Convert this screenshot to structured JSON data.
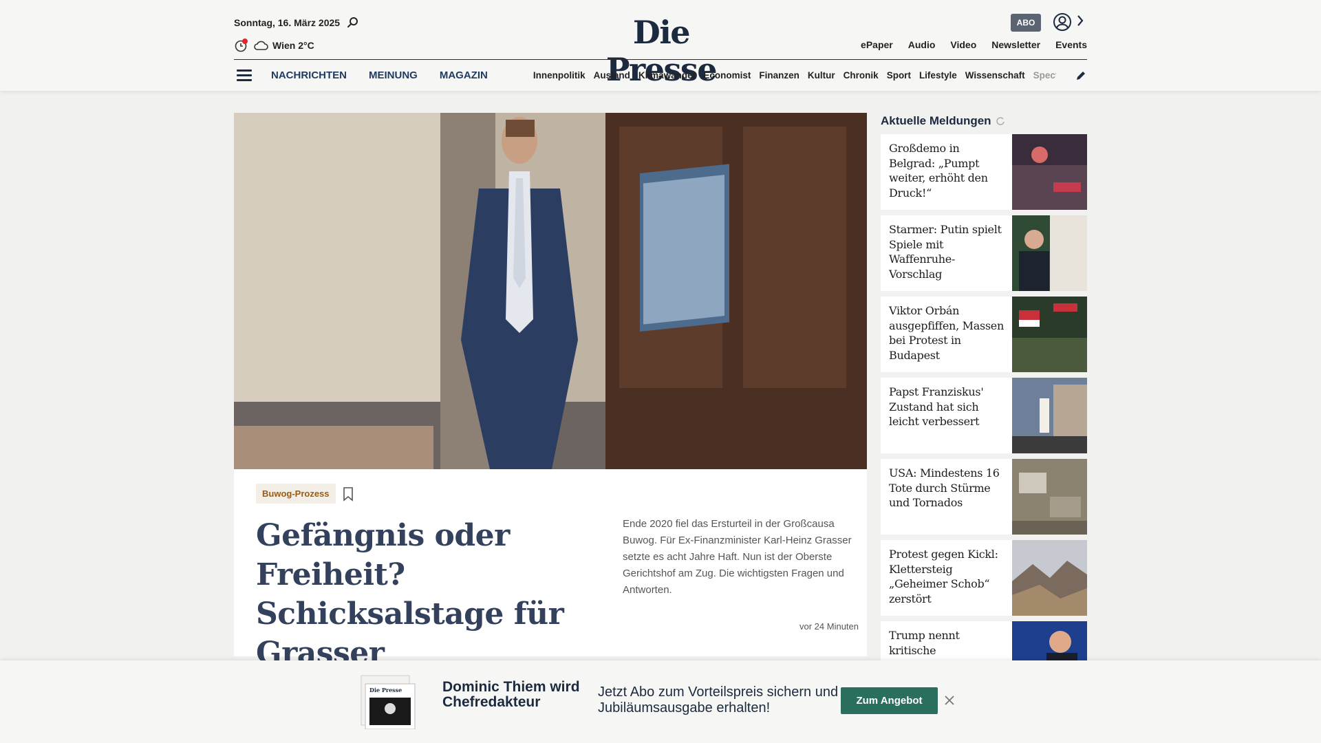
{
  "header": {
    "date": "Sonntag, 16. März 2025",
    "weather": "Wien 2°C",
    "logo": "Die Presse",
    "abo_label": "ABO",
    "top_links": [
      "ePaper",
      "Audio",
      "Video",
      "Newsletter",
      "Events"
    ],
    "nav_main": [
      "NACHRICHTEN",
      "MEINUNG",
      "MAGAZIN"
    ],
    "nav_sub": [
      "Innenpolitik",
      "Ausland",
      "Klimawandel",
      "Economist",
      "Finanzen",
      "Kultur",
      "Chronik",
      "Sport",
      "Lifestyle",
      "Wissenschaft",
      "Spectrum"
    ]
  },
  "hero": {
    "tag": "Buwog-Prozess",
    "headline": "Gefängnis oder Freiheit? Schicksalstage für Grasser",
    "teaser": "Ende 2020 fiel das Ersturteil in der Großcausa Buwog. Für Ex-Finanzminister Karl-Heinz Grasser setzte es acht Jahre Haft. Nun ist der Oberste Gerichtshof am Zug. Die wichtigsten Fragen und Antworten.",
    "time": "vor 24 Minuten"
  },
  "sidebar": {
    "title": "Aktuelle Meldungen",
    "items": [
      {
        "headline": "Großdemo in Belgrad: „Pumpt weiter, erhöht den Druck!“"
      },
      {
        "headline": "Starmer: Putin spielt Spiele mit Waffenruhe-Vorschlag"
      },
      {
        "headline": "Viktor Orbán ausgepfiffen, Massen bei Protest in Budapest"
      },
      {
        "headline": "Papst Franziskus' Zustand hat sich leicht verbessert"
      },
      {
        "headline": "USA: Mindestens 16 Tote durch Stürme und Tornados"
      },
      {
        "headline": "Protest gegen Kickl: Klettersteig „Geheimer Schob“ zerstört"
      },
      {
        "headline": "Trump nennt kritische"
      }
    ]
  },
  "promo": {
    "title": "Dominic Thiem wird Chefredakteur",
    "text": "Jetzt Abo zum Vorteilspreis sichern und Jubiläumsausgabe erhalten!",
    "button": "Zum Angebot",
    "thumb_logo": "Die Presse"
  },
  "colors": {
    "brand_navy": "#1b2a3e",
    "tag_text": "#9a5b12",
    "cta_green": "#2a6e5d",
    "notification_red": "#e0262f"
  }
}
